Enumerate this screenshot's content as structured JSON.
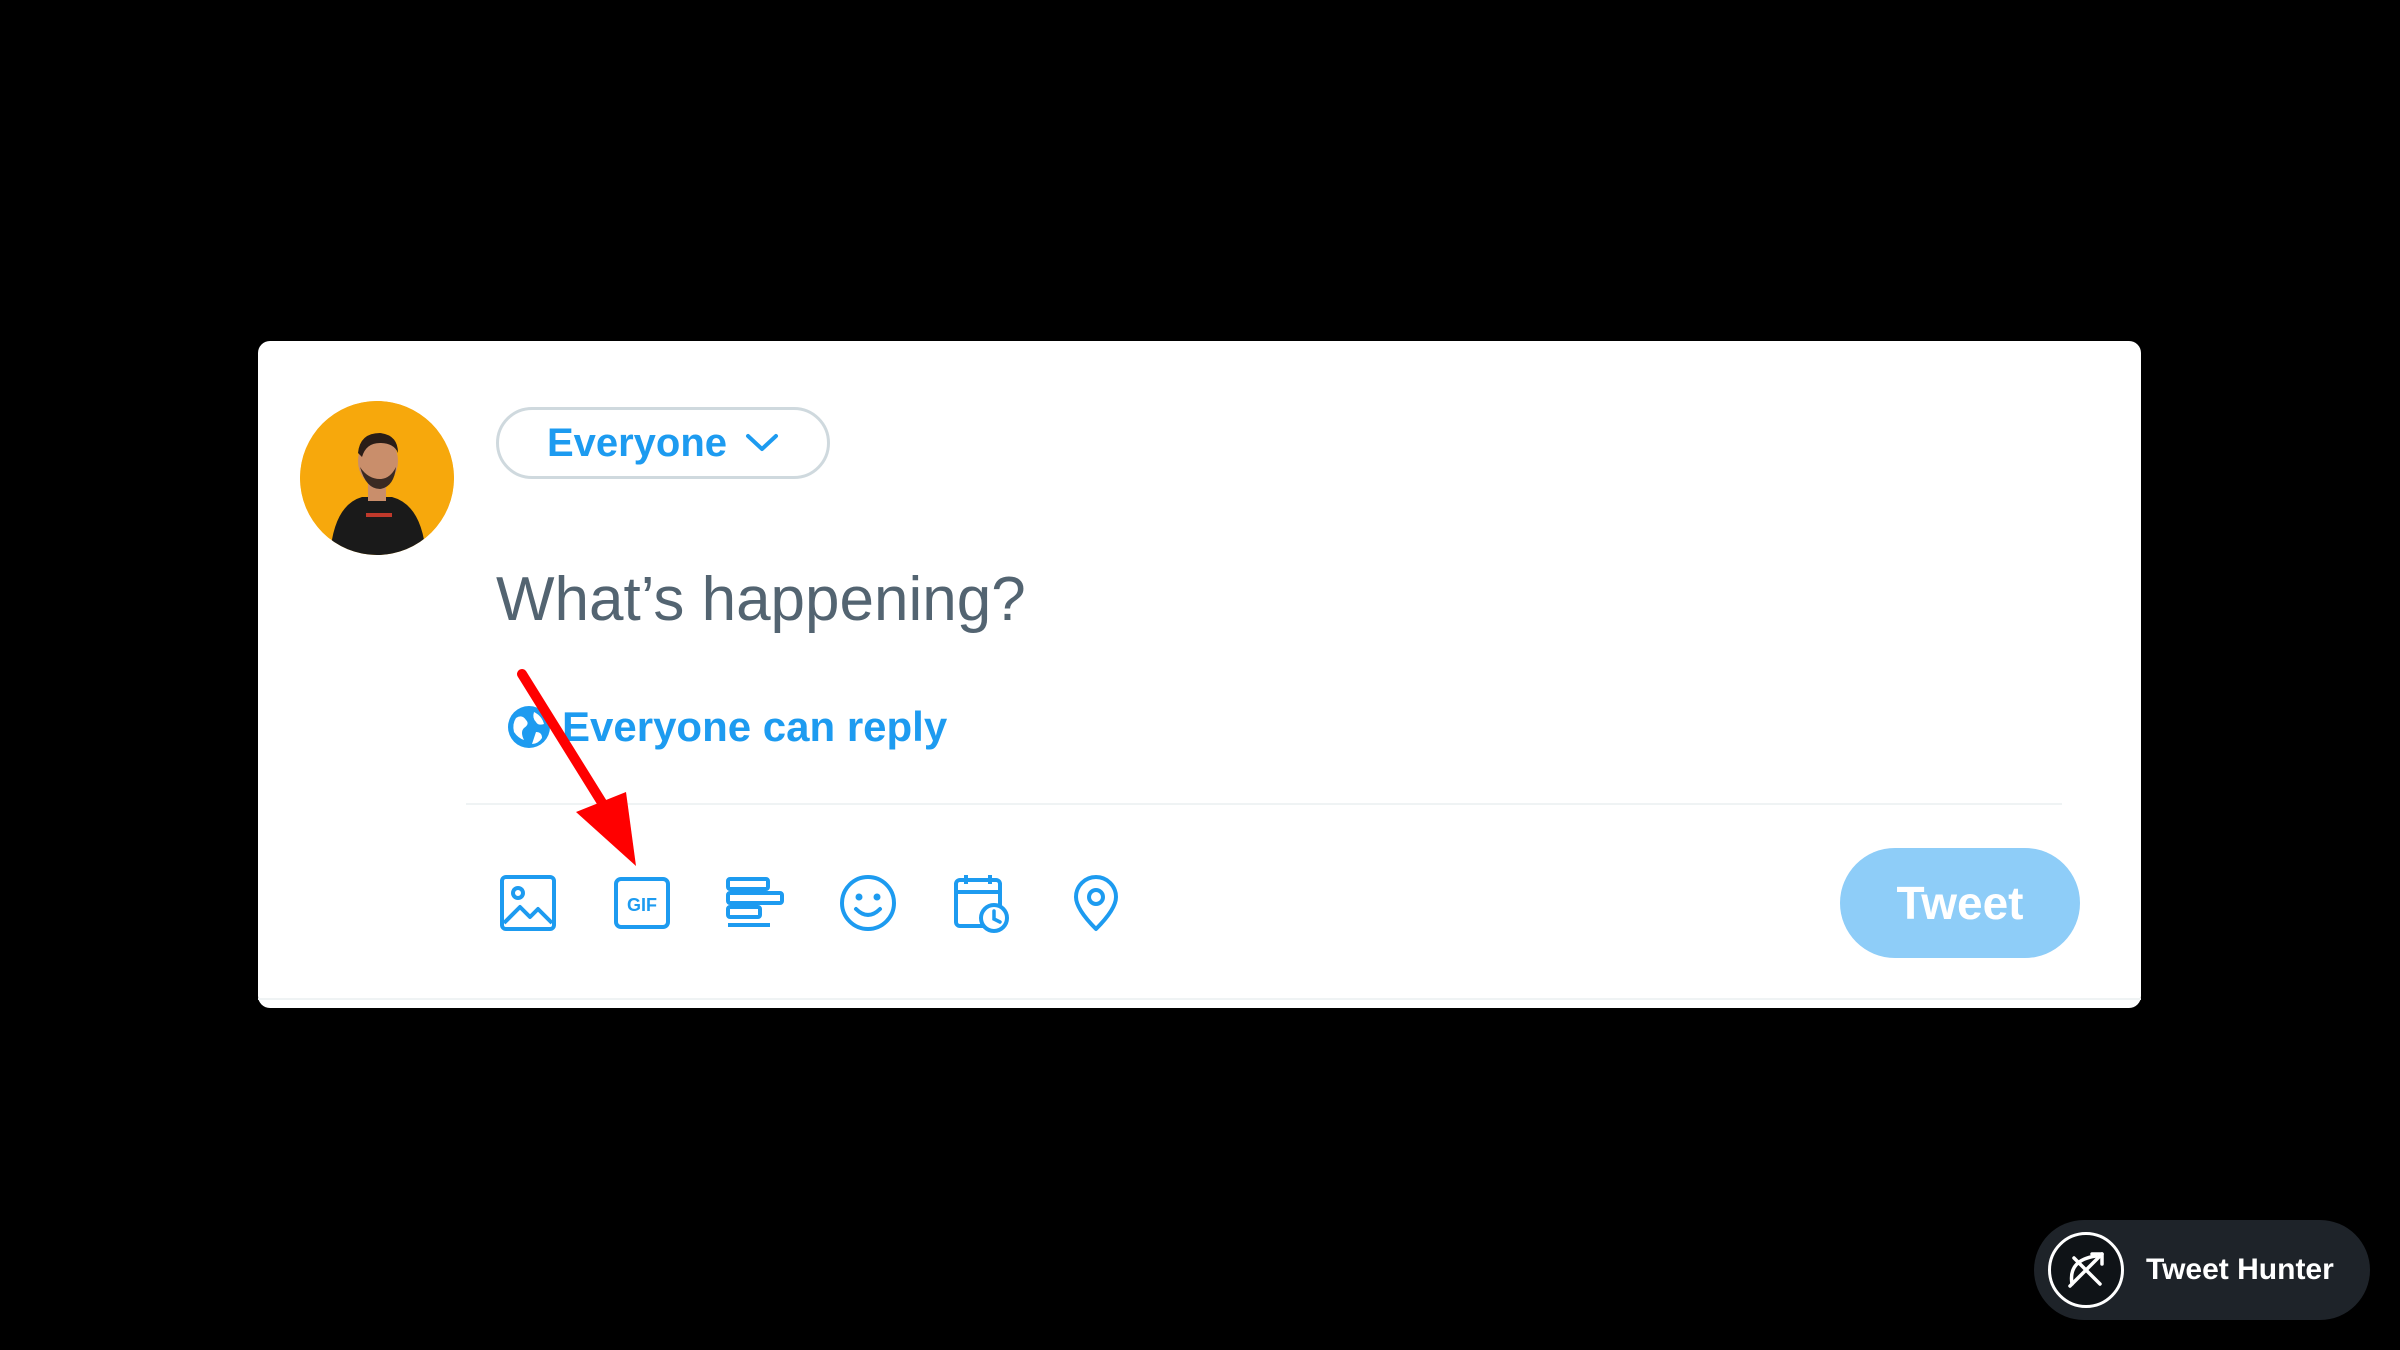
{
  "composer": {
    "audience_label": "Everyone",
    "placeholder": "What’s happening?",
    "reply_setting_label": "Everyone can reply",
    "tweet_button_label": "Tweet",
    "tweet_button_disabled": true
  },
  "toolbar": {
    "items": [
      {
        "name": "media",
        "icon": "image-icon"
      },
      {
        "name": "gif",
        "icon": "gif-icon",
        "label": "GIF"
      },
      {
        "name": "poll",
        "icon": "poll-icon"
      },
      {
        "name": "emoji",
        "icon": "emoji-icon"
      },
      {
        "name": "schedule",
        "icon": "schedule-icon"
      },
      {
        "name": "location",
        "icon": "location-icon"
      }
    ]
  },
  "annotation": {
    "arrow_color": "#ff0000",
    "points_to": "gif-button"
  },
  "branding": {
    "name": "Tweet Hunter"
  },
  "colors": {
    "accent": "#1d9bf0",
    "tweet_button_disabled": "#8ecdf8",
    "avatar_bg": "#f7a80c",
    "placeholder": "#536471",
    "background": "#000000"
  }
}
